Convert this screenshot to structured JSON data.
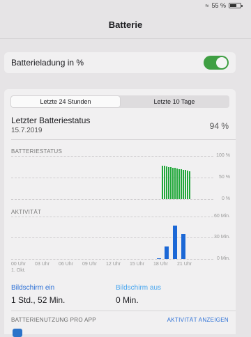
{
  "status_bar": {
    "battery_percent": "55 %"
  },
  "header": {
    "title": "Batterie"
  },
  "toggle": {
    "label": "Batterieladung in %",
    "on": true
  },
  "segment": {
    "left": "Letzte 24 Stunden",
    "right": "Letzte 10 Tage"
  },
  "last_status": {
    "title": "Letzter Batteriestatus",
    "date": "15.7.2019",
    "percent": "94 %"
  },
  "battery_chart": {
    "label": "BATTERIESTATUS",
    "y_ticks": [
      "100 %",
      "50 %",
      "0 %"
    ]
  },
  "activity_chart": {
    "label": "AKTIVITÄT",
    "y_ticks": [
      "60 Min.",
      "30 Min.",
      "0 Min."
    ]
  },
  "x_axis": {
    "ticks": [
      "00 Uhr",
      "03 Uhr",
      "06 Uhr",
      "09 Uhr",
      "12 Uhr",
      "15 Uhr",
      "18 Uhr",
      "21 Uhr"
    ],
    "sub": "1. Okt."
  },
  "screen_on": {
    "label": "Bildschirm ein",
    "value": "1 Std., 52 Min."
  },
  "screen_off": {
    "label": "Bildschirm aus",
    "value": "0 Min."
  },
  "usage": {
    "title": "BATTERIENUTZUNG PRO APP",
    "link": "AKTIVITÄT ANZEIGEN"
  },
  "chart_data": [
    {
      "type": "bar",
      "title": "BATTERIESTATUS",
      "x_range": [
        "00 Uhr",
        "21 Uhr"
      ],
      "ylim": [
        0,
        100
      ],
      "y_ticks": [
        "0 %",
        "50 %",
        "100 %"
      ],
      "series": [
        {
          "values": [
            78,
            77,
            76,
            75,
            74,
            73,
            72,
            71,
            70,
            69,
            68,
            67,
            66,
            65
          ]
        }
      ]
    },
    {
      "type": "bar",
      "title": "AKTIVITÄT",
      "ylim": [
        0,
        60
      ],
      "y_ticks": [
        "0 Min.",
        "30 Min.",
        "60 Min."
      ],
      "series": [
        {
          "values": [
            1,
            18,
            47,
            35
          ]
        }
      ]
    }
  ]
}
